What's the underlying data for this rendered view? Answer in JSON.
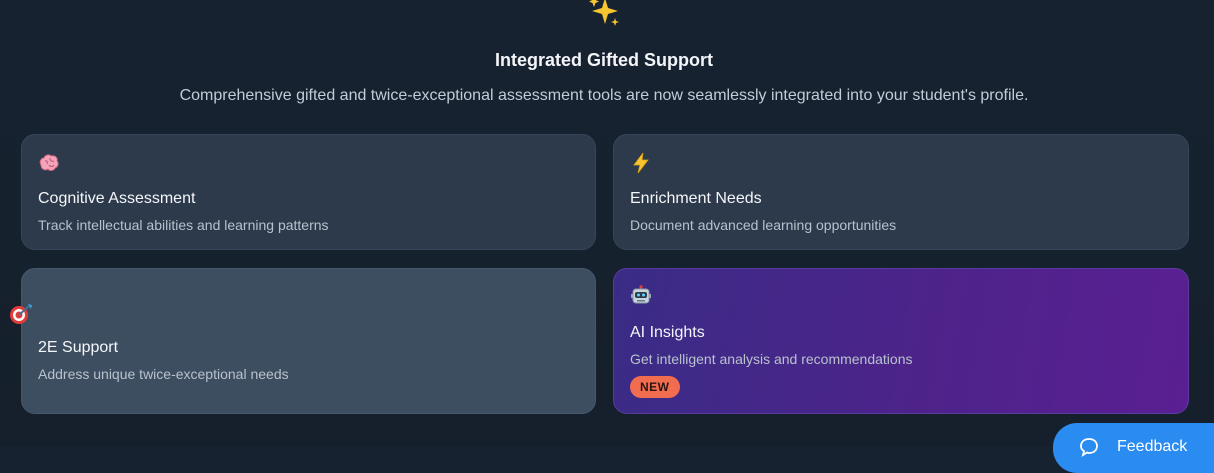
{
  "header": {
    "icon": "sparkles-icon",
    "title": "Integrated Gifted Support",
    "subtitle": "Comprehensive gifted and twice-exceptional assessment tools are now seamlessly integrated into your student's profile."
  },
  "cards": [
    {
      "icon": "brain-icon",
      "title": "Cognitive Assessment",
      "description": "Track intellectual abilities and learning patterns"
    },
    {
      "icon": "lightning-icon",
      "title": "Enrichment Needs",
      "description": "Document advanced learning opportunities"
    },
    {
      "icon": "target-dart-icon",
      "title": "2E Support",
      "description": "Address unique twice-exceptional needs"
    },
    {
      "icon": "robot-icon",
      "title": "AI Insights",
      "description": "Get intelligent analysis and recommendations",
      "badge": "NEW"
    }
  ],
  "feedback": {
    "label": "Feedback",
    "icon": "chat-icon"
  },
  "colors": {
    "background": "#172230",
    "card": "#2c3a4b",
    "card_highlight": "#3d4e60",
    "ai_gradient_start": "#3a2c86",
    "ai_gradient_end": "#5a1f92",
    "badge": "#f26d4f",
    "feedback_button": "#2a8cf0"
  }
}
